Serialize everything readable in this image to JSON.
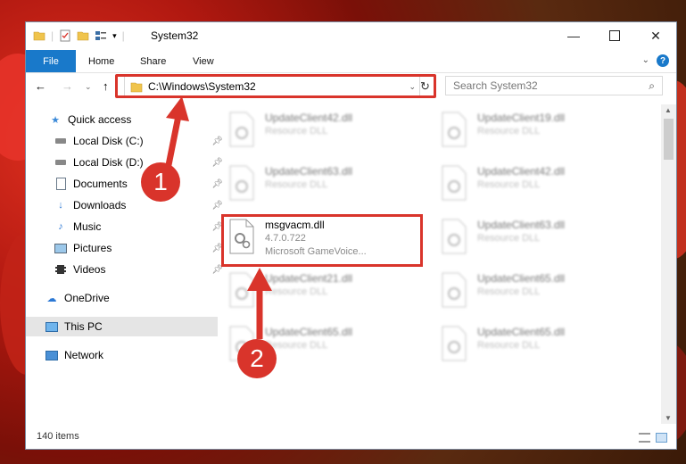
{
  "window": {
    "title": "System32",
    "controls": [
      "minimize-icon",
      "maximize-icon",
      "close-icon"
    ]
  },
  "ribbon": {
    "file_tab": "File",
    "tabs": [
      "Home",
      "Share",
      "View"
    ],
    "help": "?"
  },
  "address": {
    "path": "C:\\Windows\\System32",
    "search_placeholder": "Search System32"
  },
  "sidebar": {
    "items": [
      {
        "label": "Quick access",
        "icon": "star-icon",
        "pinned": false
      },
      {
        "label": "Local Disk (C:)",
        "icon": "drive-icon",
        "pinned": true
      },
      {
        "label": "Local Disk (D:)",
        "icon": "drive-icon",
        "pinned": true
      },
      {
        "label": "Documents",
        "icon": "documents-icon",
        "pinned": true
      },
      {
        "label": "Downloads",
        "icon": "download-icon",
        "pinned": true
      },
      {
        "label": "Music",
        "icon": "music-icon",
        "pinned": true
      },
      {
        "label": "Pictures",
        "icon": "pictures-icon",
        "pinned": true
      },
      {
        "label": "Videos",
        "icon": "videos-icon",
        "pinned": true
      },
      {
        "label": "OneDrive",
        "icon": "cloud-icon",
        "pinned": false
      },
      {
        "label": "This PC",
        "icon": "computer-icon",
        "pinned": false,
        "selected": true
      },
      {
        "label": "Network",
        "icon": "network-icon",
        "pinned": false
      }
    ]
  },
  "files": [
    {
      "name": "UpdateClient42.dll",
      "type": "Resource DLL"
    },
    {
      "name": "UpdateClient19.dll",
      "type": "Resource DLL"
    },
    {
      "name": "UpdateClient63.dll",
      "type": "Resource DLL"
    },
    {
      "name": "UpdateClient42.dll",
      "type": "Resource DLL"
    },
    {
      "name": "msgvacm.dll",
      "version": "4.7.0.722",
      "description": "Microsoft GameVoice..."
    },
    {
      "name": "UpdateClient63.dll",
      "type": "Resource DLL"
    },
    {
      "name": "UpdateClient21.dll",
      "type": "Resource DLL"
    },
    {
      "name": "UpdateClient65.dll",
      "type": "Resource DLL"
    },
    {
      "name": "UpdateClient65.dll",
      "type": "Resource DLL"
    },
    {
      "name": "UpdateClient65.dll",
      "type": "Resource DLL"
    }
  ],
  "status": {
    "item_count": "140 items"
  },
  "callouts": [
    "1",
    "2"
  ],
  "colors": {
    "accent": "#1979ca",
    "highlight": "#d9342b"
  }
}
